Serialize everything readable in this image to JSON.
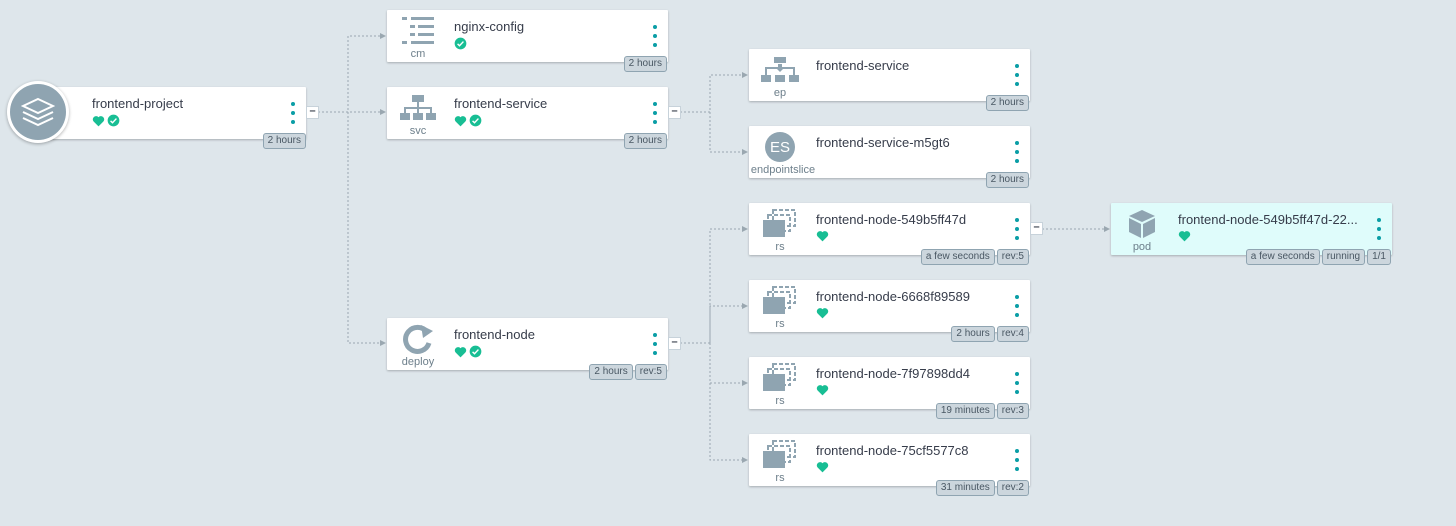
{
  "colors": {
    "health": "#18be94",
    "menu": "#0a9ea6",
    "icon": "#8fa4b1"
  },
  "nodes": {
    "project": {
      "name": "frontend-project",
      "tags": [
        "2 hours"
      ]
    },
    "cm": {
      "kind": "cm",
      "name": "nginx-config",
      "tags": [
        "2 hours"
      ]
    },
    "svc": {
      "kind": "svc",
      "name": "frontend-service",
      "tags": [
        "2 hours"
      ]
    },
    "deploy": {
      "kind": "deploy",
      "name": "frontend-node",
      "tags": [
        "2 hours",
        "rev:5"
      ]
    },
    "ep": {
      "kind": "ep",
      "name": "frontend-service",
      "tags": [
        "2 hours"
      ]
    },
    "es": {
      "kind": "endpointslice",
      "icon_text": "ES",
      "name": "frontend-service-m5gt6",
      "tags": [
        "2 hours"
      ]
    },
    "rs1": {
      "kind": "rs",
      "name": "frontend-node-549b5ff47d",
      "tags": [
        "a few seconds",
        "rev:5"
      ]
    },
    "rs2": {
      "kind": "rs",
      "name": "frontend-node-6668f89589",
      "tags": [
        "2 hours",
        "rev:4"
      ]
    },
    "rs3": {
      "kind": "rs",
      "name": "frontend-node-7f97898dd4",
      "tags": [
        "19 minutes",
        "rev:3"
      ]
    },
    "rs4": {
      "kind": "rs",
      "name": "frontend-node-75cf5577c8",
      "tags": [
        "31 minutes",
        "rev:2"
      ]
    },
    "pod": {
      "kind": "pod",
      "name": "frontend-node-549b5ff47d-22...",
      "tags": [
        "a few seconds",
        "running",
        "1/1"
      ]
    }
  },
  "collapse_symbol": "–"
}
